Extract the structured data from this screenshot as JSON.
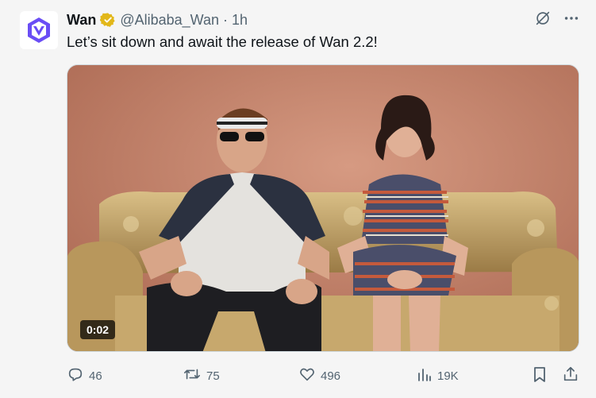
{
  "tweet": {
    "author": {
      "name": "Wan",
      "handle": "@Alibaba_Wan",
      "separator": "·",
      "time": "1h"
    },
    "text": "Let’s sit down and await the release of Wan 2.2!",
    "media": {
      "type": "video",
      "duration": "0:02"
    },
    "metrics": {
      "replies": "46",
      "reposts": "75",
      "likes": "496",
      "views": "19K"
    }
  },
  "colors": {
    "text": "#0f1419",
    "secondary": "#536471",
    "verified_badge": "#e2b719",
    "avatar_accent": "#6a4df5",
    "background": "#f5f5f5"
  },
  "icons": {
    "avatar": "wan-logo",
    "verified": "verified-badge-icon",
    "grok": "grok-icon",
    "more": "more-icon",
    "reply": "reply-icon",
    "repost": "repost-icon",
    "like": "heart-icon",
    "views": "views-icon",
    "bookmark": "bookmark-icon",
    "share": "share-icon"
  }
}
